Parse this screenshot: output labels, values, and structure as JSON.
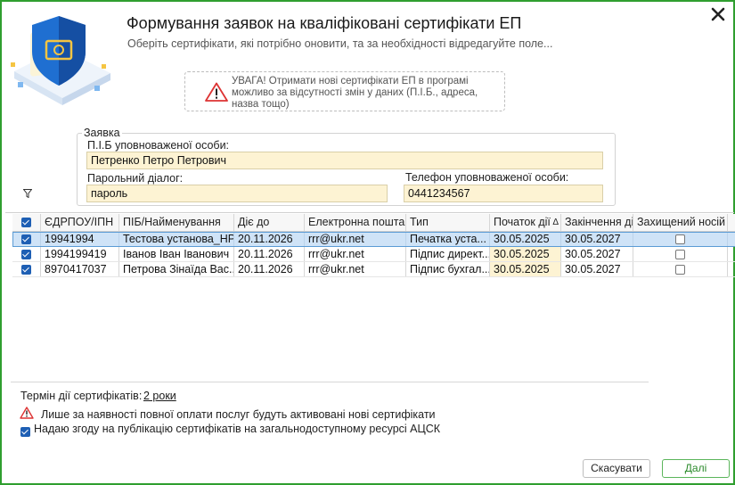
{
  "dialog": {
    "title": "Формування заявок на кваліфіковані сертифікати ЕП",
    "subtitle": "Оберіть сертифікати, які потрібно оновити, та за необхідності відредагуйте поле...",
    "warning_line1": "УВАГА! Отримати нові сертифікати ЕП в програмі",
    "warning_line2": "можливо за відсутності змін у даних (П.І.Б., адреса,",
    "warning_line3": "назва тощо)"
  },
  "request": {
    "legend": "Заявка",
    "person_label": "П.І.Б уповноваженої особи:",
    "person_value": "Петренко Петро Петрович",
    "password_label": "Парольний діалог:",
    "password_value": "пароль",
    "phone_label": "Телефон уповноваженої особи:",
    "phone_value": "0441234567"
  },
  "table": {
    "columns": [
      "ЄДРПОУ/ІПН",
      "ПІБ/Найменування",
      "Діє до",
      "Електронна пошта",
      "Тип",
      "Початок дії",
      "Закінчення дії",
      "Захищений носій"
    ],
    "sort_indicator": "Δ",
    "rows": [
      {
        "checked": true,
        "code": "19941994",
        "name": "Тестова установа_НР",
        "valid_to": "20.11.2026",
        "email": "rrr@ukr.net",
        "type": "Печатка уста...",
        "start": "30.05.2025",
        "end": "30.05.2027",
        "protected": false
      },
      {
        "checked": true,
        "code": "1994199419",
        "name": "Іванов Іван Іванович",
        "valid_to": "20.11.2026",
        "email": "rrr@ukr.net",
        "type": "Підпис директ...",
        "start": "30.05.2025",
        "end": "30.05.2027",
        "protected": false
      },
      {
        "checked": true,
        "code": "8970417037",
        "name": "Петрова Зінаїда Вас...",
        "valid_to": "20.11.2026",
        "email": "rrr@ukr.net",
        "type": "Підпис бухгал...",
        "start": "30.05.2025",
        "end": "30.05.2027",
        "protected": false
      }
    ]
  },
  "footer": {
    "term_label": "Термін дії сертифікатів:",
    "term_value": "2 роки",
    "payment_note": "Лише за наявності повної оплати послуг будуть активовані нові сертифікати",
    "agree_text": "Надаю згоду на публікацію сертифікатів на загальнодоступному ресурсі АЦСК",
    "agree_checked": true,
    "cancel_label": "Скасувати",
    "next_label": "Далі"
  },
  "colors": {
    "window_border": "#2f9e2f",
    "selected_row": "#cfe3f7",
    "field_fill": "#fdf3d3",
    "checkbox": "#1e5fb4",
    "warning_red": "#d33"
  },
  "icons": [
    "certificate-shield-illustration",
    "close-icon",
    "warning-icon",
    "filter-icon"
  ]
}
